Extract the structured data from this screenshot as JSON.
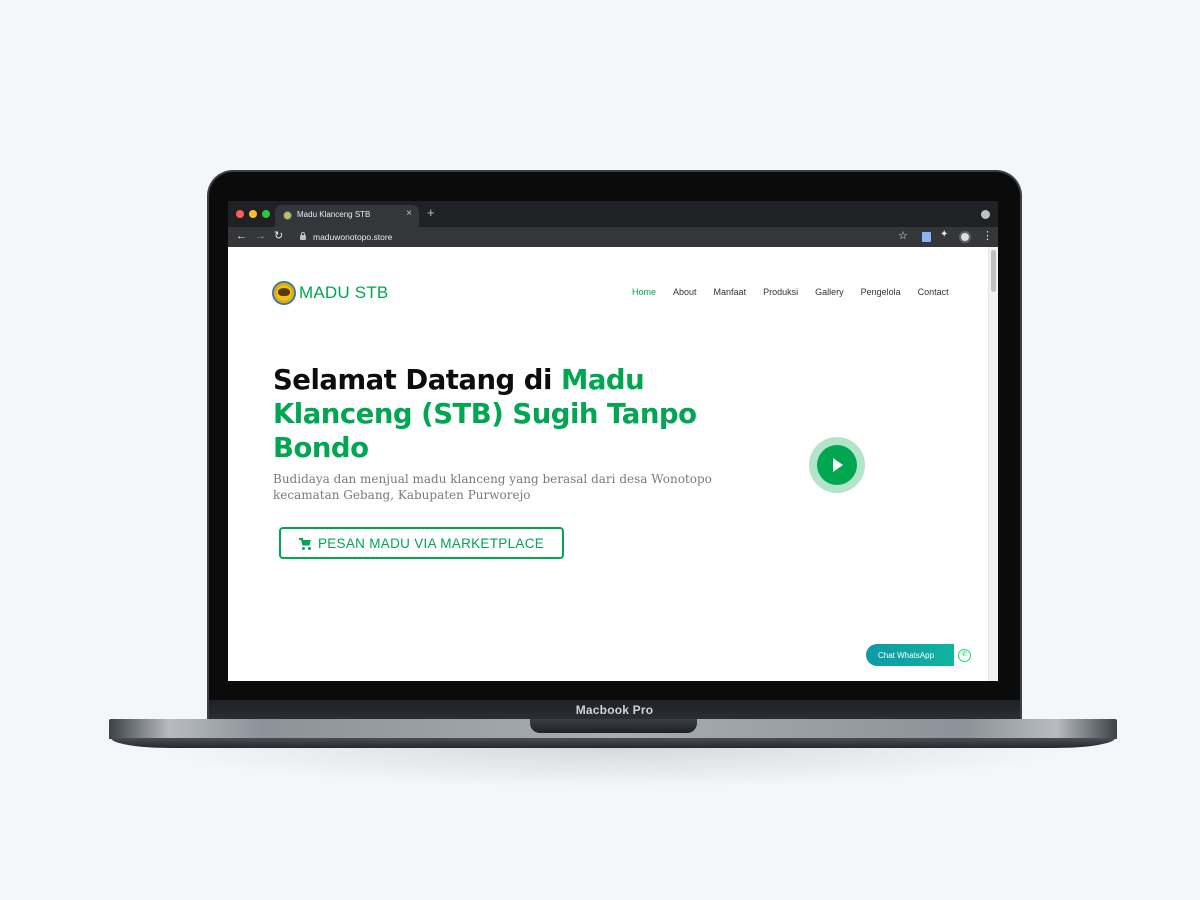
{
  "device": {
    "label": "Macbook Pro"
  },
  "browser": {
    "tab_title": "Madu Klanceng STB",
    "tab_close_glyph": "×",
    "new_tab_glyph": "+",
    "url": "maduwonotopo.store"
  },
  "site": {
    "logo_text": "MADU STB",
    "nav": [
      "Home",
      "About",
      "Manfaat",
      "Produksi",
      "Gallery",
      "Pengelola",
      "Contact"
    ],
    "active_nav": "Home",
    "hero": {
      "title_part1": "Selamat Datang di ",
      "title_part2": "Madu Klanceng (STB) Sugih Tanpo Bondo",
      "subtitle": "Budidaya dan menjual madu klanceng yang berasal dari desa Wonotopo kecamatan Gebang, Kabupaten Purworejo",
      "cta_label": "PESAN MADU VIA MARKETPLACE"
    },
    "whatsapp_label": "Chat WhatsApp"
  },
  "colors": {
    "accent": "#00a650",
    "background": "#f3f7fa",
    "whatsapp": "#25d366"
  },
  "icons": [
    "lock-icon",
    "star-icon",
    "extension-icon",
    "avatar-icon",
    "menu-icon",
    "cart-icon",
    "play-icon",
    "whatsapp-icon"
  ]
}
